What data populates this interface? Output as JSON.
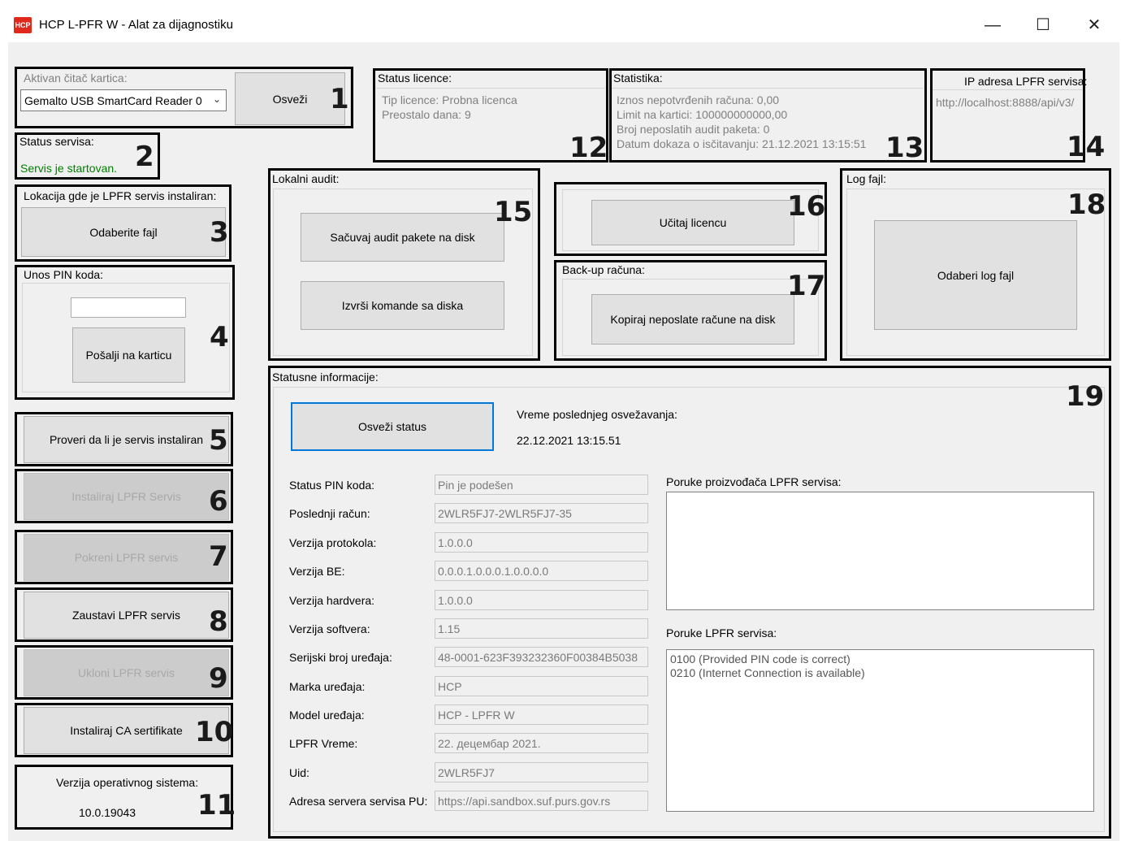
{
  "window": {
    "icon_text": "HCP",
    "title": "HCP L-PFR W - Alat za dijagnostiku",
    "minimize": "—",
    "maximize": "☐",
    "close": "✕"
  },
  "reader": {
    "label": "Aktivan čitač kartica:",
    "value": "Gemalto USB SmartCard Reader 0",
    "refresh": "Osveži",
    "num": "1"
  },
  "service_status": {
    "label": "Status servisa:",
    "value": "Servis je startovan.",
    "num": "2",
    "value_color": "#008000"
  },
  "location": {
    "label": "Lokacija gde je LPFR servis instaliran:",
    "button": "Odaberite fajl",
    "num": "3"
  },
  "pin": {
    "label": "Unos PIN koda:",
    "value": "",
    "button": "Pošalji na karticu",
    "num": "4"
  },
  "service_buttons": [
    {
      "label": "Proveri da li je servis instaliran",
      "num": "5",
      "enabled": true
    },
    {
      "label": "Instaliraj LPFR Servis",
      "num": "6",
      "enabled": false
    },
    {
      "label": "Pokreni LPFR servis",
      "num": "7",
      "enabled": false
    },
    {
      "label": "Zaustavi LPFR servis",
      "num": "8",
      "enabled": true
    },
    {
      "label": "Ukloni LPFR servis",
      "num": "9",
      "enabled": false
    },
    {
      "label": "Instaliraj CA sertifikate",
      "num": "10",
      "enabled": true
    }
  ],
  "os": {
    "label": "Verzija operativnog sistema:",
    "value": "10.0.19043",
    "num": "11"
  },
  "license": {
    "label": "Status licence:",
    "type": "Tip licence: Probna licenca",
    "days": "Preostalo dana: 9",
    "num": "12"
  },
  "stats": {
    "label": "Statistika:",
    "lines": [
      "Iznos nepotvrđenih računa: 0,00",
      "Limit na kartici: 100000000000,00",
      "Broj neposlatih audit paketa: 0",
      "Datum dokaza o isčitavanju: 21.12.2021 13:15:51"
    ],
    "num": "13"
  },
  "ip": {
    "label": "IP adresa LPFR servisa:",
    "value": "http://localhost:8888/api/v3/",
    "num": "14"
  },
  "audit": {
    "label": "Lokalni audit:",
    "save": "Sačuvaj audit pakete na disk",
    "exec": "Izvrši komande sa diska",
    "num": "15"
  },
  "load_license": {
    "button": "Učitaj licencu",
    "num": "16"
  },
  "backup": {
    "label": "Back-up računa:",
    "button": "Kopiraj neposlate račune na disk",
    "num": "17"
  },
  "logfile": {
    "label": "Log fajl:",
    "button": "Odaberi log fajl",
    "num": "18"
  },
  "status_info": {
    "label": "Statusne informacije:",
    "refresh": "Osveži status",
    "last_refresh_label": "Vreme poslednjeg osvežavanja:",
    "last_refresh_value": "22.12.2021 13:15.51",
    "num": "19",
    "fields": [
      {
        "label": "Status PIN koda:",
        "value": "Pin je podešen"
      },
      {
        "label": "Poslednji račun:",
        "value": "2WLR5FJ7-2WLR5FJ7-35"
      },
      {
        "label": "Verzija protokola:",
        "value": "1.0.0.0"
      },
      {
        "label": "Verzija BE:",
        "value": "0.0.0.1.0.0.0.1.0.0.0.0"
      },
      {
        "label": "Verzija hardvera:",
        "value": "1.0.0.0"
      },
      {
        "label": "Verzija softvera:",
        "value": "1.15"
      },
      {
        "label": "Serijski broj uređaja:",
        "value": "48-0001-623F393232360F00384B5038"
      },
      {
        "label": "Marka uređaja:",
        "value": "HCP"
      },
      {
        "label": "Model uređaja:",
        "value": "HCP - LPFR W"
      },
      {
        "label": "LPFR Vreme:",
        "value": "22. децембар 2021."
      },
      {
        "label": "Uid:",
        "value": "2WLR5FJ7"
      },
      {
        "label": "Adresa servera servisa PU:",
        "value": "https://api.sandbox.suf.purs.gov.rs"
      }
    ],
    "manufacturer_label": "Poruke proizvođača LPFR servisa:",
    "manufacturer_messages": "",
    "service_label": "Poruke LPFR servisa:",
    "service_messages": [
      "0100 (Provided PIN code is correct)",
      "0210 (Internet Connection is available)"
    ]
  }
}
